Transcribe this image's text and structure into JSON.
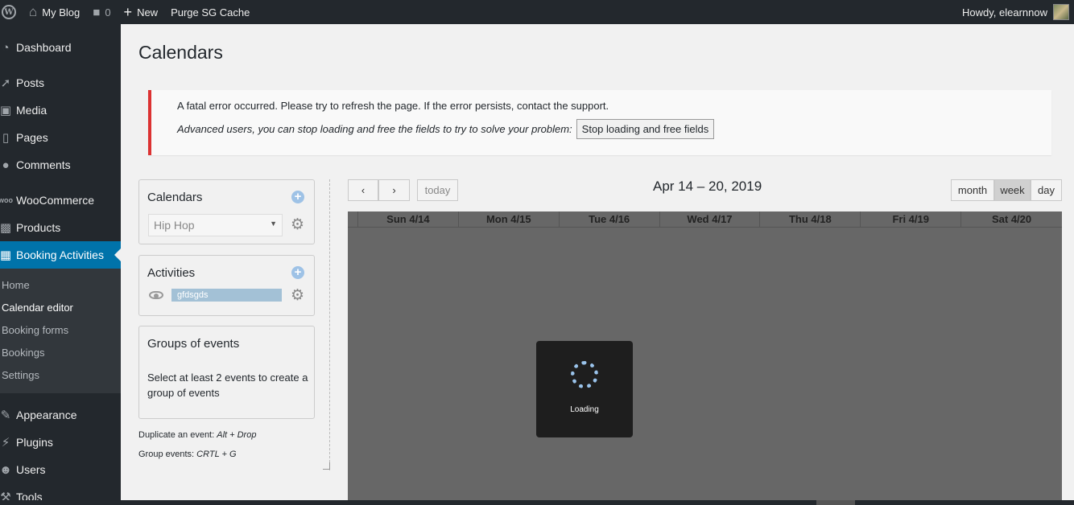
{
  "adminbar": {
    "site_name": "My Blog",
    "comments_count": "0",
    "new_label": "New",
    "purge_label": "Purge SG Cache",
    "howdy": "Howdy, elearnnow"
  },
  "sidebar": {
    "items": [
      {
        "label": "Dashboard",
        "icon": "dashboard-icon"
      },
      {
        "label": "Posts",
        "icon": "pin-icon"
      },
      {
        "label": "Media",
        "icon": "media-icon"
      },
      {
        "label": "Pages",
        "icon": "pages-icon"
      },
      {
        "label": "Comments",
        "icon": "comment-icon"
      },
      {
        "label": "WooCommerce",
        "icon": "woo-icon"
      },
      {
        "label": "Products",
        "icon": "box-icon"
      },
      {
        "label": "Booking Activities",
        "icon": "calendar-icon"
      },
      {
        "label": "Appearance",
        "icon": "brush-icon"
      },
      {
        "label": "Plugins",
        "icon": "plug-icon"
      },
      {
        "label": "Users",
        "icon": "user-icon"
      },
      {
        "label": "Tools",
        "icon": "wrench-icon"
      }
    ],
    "submenu": [
      "Home",
      "Calendar editor",
      "Booking forms",
      "Bookings",
      "Settings"
    ]
  },
  "page": {
    "title": "Calendars"
  },
  "notice": {
    "message": "A fatal error occurred. Please try to refresh the page. If the error persists, contact the support.",
    "advanced": "Advanced users, you can stop loading and free the fields to try to solve your problem:",
    "button": "Stop loading and free fields"
  },
  "calendars_box": {
    "title": "Calendars",
    "selected": "Hip Hop"
  },
  "activities_box": {
    "title": "Activities",
    "activity": "gfdsgds"
  },
  "groups_box": {
    "title": "Groups of events",
    "description": "Select at least 2 events to create a group of events"
  },
  "hints": {
    "duplicate_label": "Duplicate an event: ",
    "duplicate_keys": "Alt + Drop",
    "group_label": "Group events: ",
    "group_keys": "CRTL + G"
  },
  "calendar": {
    "today": "today",
    "range": "Apr 14 – 20, 2019",
    "views": [
      "month",
      "week",
      "day"
    ],
    "active_view": "week",
    "days": [
      "Sun 4/14",
      "Mon 4/15",
      "Tue 4/16",
      "Wed 4/17",
      "Thu 4/18",
      "Fri 4/19",
      "Sat 4/20"
    ],
    "loading": "Loading"
  },
  "colors": {
    "admin_dark": "#23282d",
    "accent": "#0073aa",
    "error": "#dc3232",
    "overlay": "#676767"
  }
}
